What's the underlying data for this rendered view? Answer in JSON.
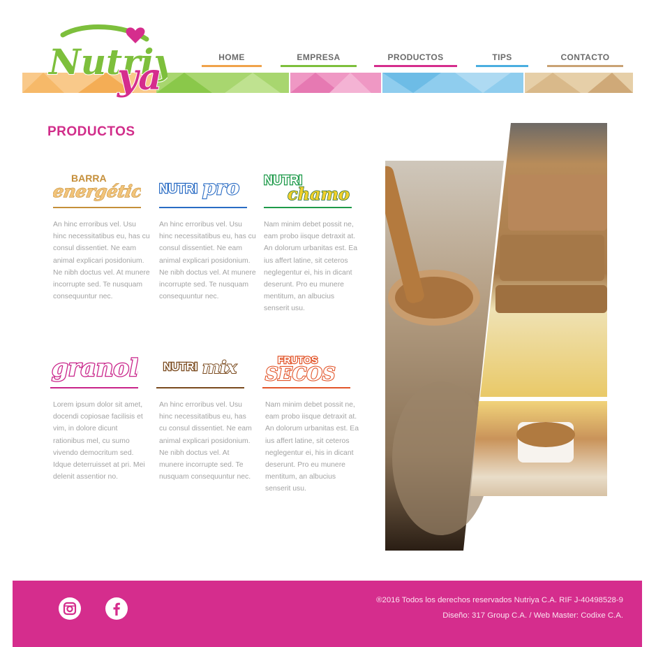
{
  "brand": {
    "name": "Nutriya",
    "logo_text": "Nutriya",
    "colors": {
      "pink": "#d52d8d",
      "green": "#7dbf3c",
      "orange": "#f4a84b",
      "blue": "#4aaee0",
      "tan": "#c9a274"
    }
  },
  "nav": {
    "items": [
      {
        "label": "HOME",
        "color": "#f0a24a"
      },
      {
        "label": "EMPRESA",
        "color": "#7dbf3c"
      },
      {
        "label": "PRODUCTOS",
        "color": "#d52d8d"
      },
      {
        "label": "TIPS",
        "color": "#4aaee0"
      },
      {
        "label": "CONTACTO",
        "color": "#c9a274"
      }
    ]
  },
  "page": {
    "title": "PRODUCTOS"
  },
  "products": [
    {
      "logo_text": [
        "BARRA",
        "energética"
      ],
      "color": "#c58f3a",
      "description": "An hinc erroribus vel. Usu hinc necessitatibus eu, has cu consul dissentiet. Ne eam animal explicari posidonium. Ne nibh doctus vel. At munere incorrupte sed. Te nusquam consequuntur nec."
    },
    {
      "logo_text": [
        "NUTRI",
        "pro"
      ],
      "color": "#2a6cc4",
      "description": "An hinc erroribus vel. Usu hinc necessitatibus eu, has cu consul dissentiet. Ne eam animal explicari posidonium. Ne nibh doctus vel. At munere incorrupte sed. Te nusquam consequuntur nec."
    },
    {
      "logo_text": [
        "NUTRI",
        "chamo"
      ],
      "color": "#1e9a4a",
      "description": "Nam minim debet possit ne, eam probo iisque detraxit at. An dolorum urbanitas est. Ea ius affert latine, sit ceteros neglegentur ei, his in dicant deserunt. Pro eu munere mentitum, an albucius senserit usu."
    },
    {
      "logo_text": [
        "granola"
      ],
      "color": "#c9248a",
      "description": "Lorem ipsum dolor sit amet, docendi copiosae facilisis et vim, in dolore dicunt rationibus mel, cu sumo vivendo democritum sed. Idque deterruisset at pri. Mei delenit assentior no."
    },
    {
      "logo_text": [
        "NUTRI",
        "mix"
      ],
      "color": "#7a4a1e",
      "description": "An hinc erroribus vel. Usu hinc necessitatibus eu, has cu consul dissentiet. Ne eam animal explicari posidonium. Ne nibh doctus vel. At munere incorrupte sed. Te nusquam consequuntur nec."
    },
    {
      "logo_text": [
        "FRUTOS",
        "SECOS"
      ],
      "color": "#e2552a",
      "description": "Nam minim debet possit ne, eam probo iisque detraxit at. An dolorum urbanitas est. Ea ius affert latine, sit ceteros neglegentur ei, his in dicant deserunt. Pro eu munere mentitum, an albucius senserit usu."
    }
  ],
  "footer": {
    "social": [
      {
        "icon": "instagram-icon"
      },
      {
        "icon": "facebook-icon"
      }
    ],
    "copyright": "®2016 Todos los derechos reservados Nutriya C.A. RIF J-40498528-9",
    "credits": "Diseño: 317 Group C.A. / Web Master: Codixe C.A."
  }
}
